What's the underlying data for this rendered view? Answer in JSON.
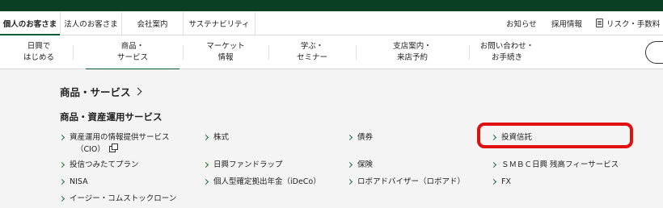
{
  "header": {
    "audience_tabs": [
      "個人のお客さま",
      "法人のお客さま",
      "会社案内",
      "サステナビリティ"
    ],
    "utility_links": [
      "お知らせ",
      "採用情報",
      "リスク・手数料"
    ]
  },
  "nav": {
    "items": [
      {
        "label": "日興で\nはじめる"
      },
      {
        "label": "商品・\nサービス"
      },
      {
        "label": "マーケット\n情報"
      },
      {
        "label": "学ぶ・\nセミナー"
      },
      {
        "label": "支店案内・\n来店予約"
      },
      {
        "label": "お問い合わせ・\nお手続き"
      }
    ]
  },
  "mega_menu": {
    "title": "商品・サービス",
    "section_title": "商品・資産運用サービス",
    "links": [
      {
        "label": "資産運用の情報提供サービス",
        "label2": "（CIO）"
      },
      {
        "label": "株式"
      },
      {
        "label": "債券"
      },
      {
        "label": "投資信託"
      },
      {
        "label": "投信つみたてプラン"
      },
      {
        "label": "日興ファンドラップ"
      },
      {
        "label": "保険"
      },
      {
        "label": "ＳＭＢＣ日興 残高フィーサービス"
      },
      {
        "label": "NISA"
      },
      {
        "label": "個人型確定拠出年金（iDeCo）"
      },
      {
        "label": "ロボアドバイザー（ロボアド）"
      },
      {
        "label": "FX"
      },
      {
        "label": "イージー・コムストックローン"
      }
    ]
  },
  "colors": {
    "brand_green": "#0b3f24",
    "accent_green": "#1a6a3b",
    "highlight_red": "#e01010"
  }
}
